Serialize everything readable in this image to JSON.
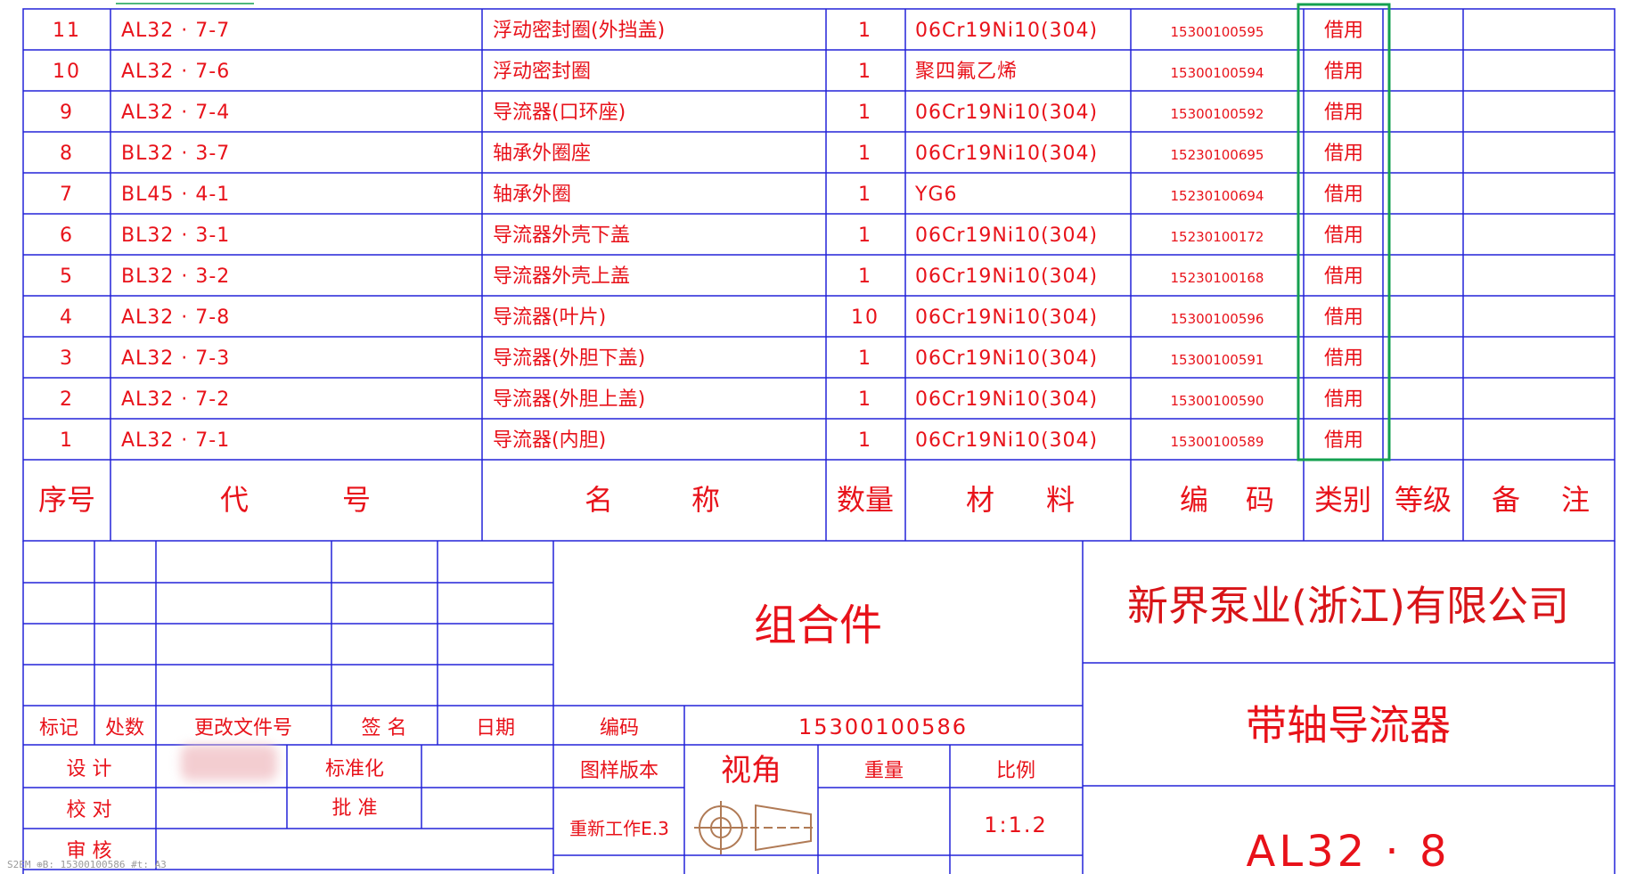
{
  "rows": [
    {
      "no": "11",
      "code": "AL32 · 7-7",
      "name": "浮动密封圈(外挡盖)",
      "qty": "1",
      "material": "06Cr19Ni10(304)",
      "part_code": "15300100595",
      "category": "借用"
    },
    {
      "no": "10",
      "code": "AL32 · 7-6",
      "name": "浮动密封圈",
      "qty": "1",
      "material": "聚四氟乙烯",
      "part_code": "15300100594",
      "category": "借用"
    },
    {
      "no": "9",
      "code": "AL32 · 7-4",
      "name": "导流器(口环座)",
      "qty": "1",
      "material": "06Cr19Ni10(304)",
      "part_code": "15300100592",
      "category": "借用"
    },
    {
      "no": "8",
      "code": "BL32 · 3-7",
      "name": "轴承外圈座",
      "qty": "1",
      "material": "06Cr19Ni10(304)",
      "part_code": "15230100695",
      "category": "借用"
    },
    {
      "no": "7",
      "code": "BL45 · 4-1",
      "name": "轴承外圈",
      "qty": "1",
      "material": "YG6",
      "part_code": "15230100694",
      "category": "借用"
    },
    {
      "no": "6",
      "code": "BL32 · 3-1",
      "name": "导流器外壳下盖",
      "qty": "1",
      "material": "06Cr19Ni10(304)",
      "part_code": "15230100172",
      "category": "借用"
    },
    {
      "no": "5",
      "code": "BL32 · 3-2",
      "name": "导流器外壳上盖",
      "qty": "1",
      "material": "06Cr19Ni10(304)",
      "part_code": "15230100168",
      "category": "借用"
    },
    {
      "no": "4",
      "code": "AL32 · 7-8",
      "name": "导流器(叶片)",
      "qty": "10",
      "material": "06Cr19Ni10(304)",
      "part_code": "15300100596",
      "category": "借用"
    },
    {
      "no": "3",
      "code": "AL32 · 7-3",
      "name": "导流器(外胆下盖)",
      "qty": "1",
      "material": "06Cr19Ni10(304)",
      "part_code": "15300100591",
      "category": "借用"
    },
    {
      "no": "2",
      "code": "AL32 · 7-2",
      "name": "导流器(外胆上盖)",
      "qty": "1",
      "material": "06Cr19Ni10(304)",
      "part_code": "15300100590",
      "category": "借用"
    },
    {
      "no": "1",
      "code": "AL32 · 7-1",
      "name": "导流器(内胆)",
      "qty": "1",
      "material": "06Cr19Ni10(304)",
      "part_code": "15300100589",
      "category": "借用"
    }
  ],
  "header": {
    "no": "序号",
    "code_a": "代",
    "code_b": "号",
    "name_a": "名",
    "name_b": "称",
    "qty": "数量",
    "material_a": "材",
    "material_b": "料",
    "part_code_a": "编",
    "part_code_b": "码",
    "category": "类别",
    "grade": "等级",
    "remarks_a": "备",
    "remarks_b": "注"
  },
  "title_block": {
    "label_mark": "标记",
    "label_count": "处数",
    "label_change_doc": "更改文件号",
    "label_sign": "签 名",
    "label_date": "日期",
    "label_design": "设 计",
    "label_standardize": "标准化",
    "label_check": "校 对",
    "label_approve": "批 准",
    "label_review": "审 核",
    "assembly_title": "组合件",
    "label_code": "编码",
    "code_value": "15300100586",
    "label_template_version": "图样版本",
    "label_view": "视角",
    "label_weight": "重量",
    "label_scale": "比例",
    "template_version_value": "重新工作E.3",
    "scale_value": "1:1.2",
    "company": "新界泵业(浙江)有限公司",
    "drawing_name": "带轴导流器",
    "drawing_number": "AL32 · 8"
  },
  "status_bar": "S2EM  ⊕B: 15300100586  #t: A3",
  "colors": {
    "text": "#e8121a",
    "lines": "#2323d8",
    "highlight": "#14a050",
    "company": "#d81418",
    "symbol": "#b07a55"
  }
}
